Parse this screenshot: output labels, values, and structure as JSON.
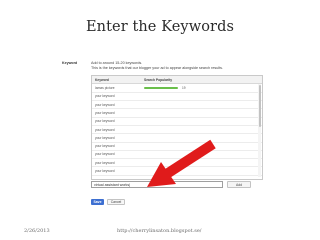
{
  "slide": {
    "title": "Enter the Keywords",
    "footer_date": "2/26/2013",
    "footer_url": "http://cherrylinsaton.blogspot.se/"
  },
  "form": {
    "section_label": "Keyword",
    "intro_line1": "Add to around 15-20 keywords.",
    "intro_line2": "This is the keywords that our blogger your ad to appear alongside search results.",
    "columns": {
      "keyword": "Keyword",
      "popularity": "Search Popularity"
    },
    "rows": [
      {
        "keyword": "lamas picture",
        "popularity_value": "19",
        "popularity_fraction": 0.78
      },
      {
        "keyword": "your keyword"
      },
      {
        "keyword": "your keyword"
      },
      {
        "keyword": "your keyword"
      },
      {
        "keyword": "your keyword"
      },
      {
        "keyword": "your keyword"
      },
      {
        "keyword": "your keyword"
      },
      {
        "keyword": "your keyword"
      },
      {
        "keyword": "your keyword"
      },
      {
        "keyword": "your keyword"
      },
      {
        "keyword": "your keyword"
      }
    ],
    "input_value": "virtual assistant works|",
    "add_label": "Add",
    "save_label": "Save",
    "cancel_label": "Cancel"
  },
  "colors": {
    "popularity_bar": "#6abf4b",
    "save_button": "#3d6fd1",
    "arrow": "#e01b1b"
  }
}
